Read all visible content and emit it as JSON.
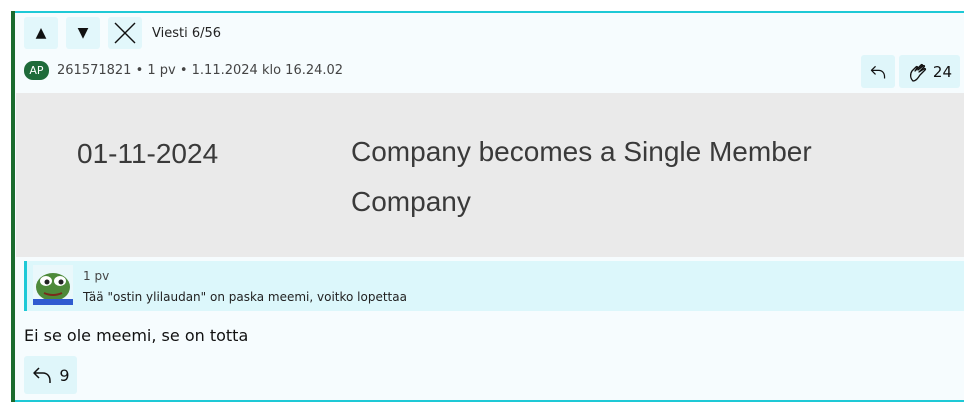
{
  "nav": {
    "up_icon": "▲",
    "down_icon": "▼",
    "counter": "Viesti 6/56"
  },
  "post": {
    "avatar_initials": "AP",
    "meta": "261571821 • 1 pv • 1.11.2024 klo 16.24.02",
    "upvotes": "24",
    "image": {
      "date": "01-11-2024",
      "event": "Company becomes a Single Member Company"
    },
    "quote": {
      "time": "1 pv",
      "text": "Tää \"ostin ylilaudan\" on paska meemi, voitko lopettaa"
    },
    "body": "Ei se ole meemi, se on totta",
    "reply_count": "9"
  },
  "colors": {
    "accent": "#1ec9d6",
    "author_green": "#1f6b3a",
    "card_bg": "#f6fcfe"
  }
}
